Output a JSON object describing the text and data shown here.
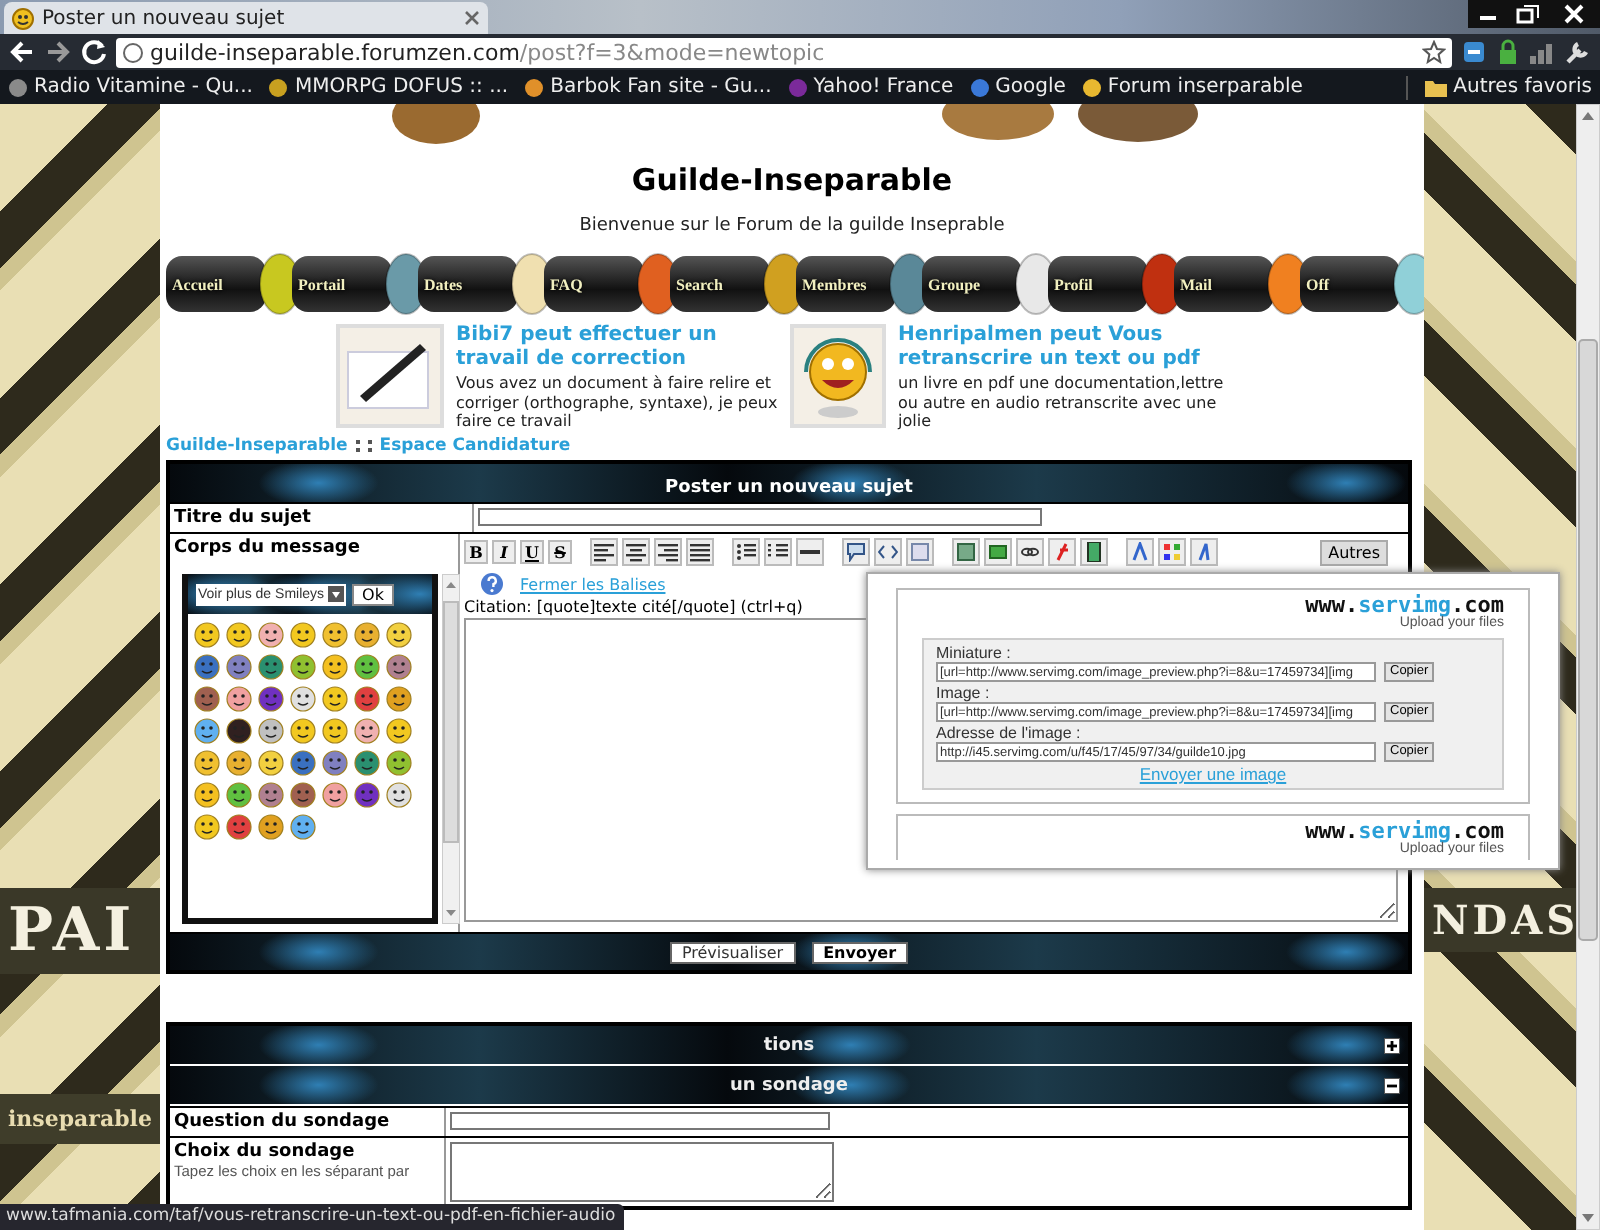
{
  "browser": {
    "tab_title": "Poster un nouveau sujet",
    "url_host": "guilde-inseparable.forumzen.com",
    "url_path": "/post?f=3&mode=newtopic",
    "bookmarks": [
      {
        "label": "Radio Vitamine - Qu...",
        "color": "#8a8a8a"
      },
      {
        "label": "MMORPG DOFUS :: ...",
        "color": "#c8a020"
      },
      {
        "label": "Barbok Fan site - Gu...",
        "color": "#e0902a"
      },
      {
        "label": "Yahoo! France",
        "color": "#7b2a9a"
      },
      {
        "label": "Google",
        "color": "#3a78d8"
      },
      {
        "label": "Forum inserparable",
        "color": "#e8b830"
      }
    ],
    "other_bookmarks": "Autres favoris"
  },
  "side": {
    "left_banner": "PAI",
    "right_banner": "NDAS",
    "left_label": "inseparable"
  },
  "header": {
    "title": "Guilde-Inseparable",
    "subtitle": "Bienvenue sur le Forum de la guilde Inseprable"
  },
  "nav": [
    {
      "label": "Accueil",
      "color": "#c8c820"
    },
    {
      "label": "Portail",
      "color": "#6a9aa8"
    },
    {
      "label": "Dates",
      "color": "#f0e0b0"
    },
    {
      "label": "FAQ",
      "color": "#e06020"
    },
    {
      "label": "Search",
      "color": "#d0a020"
    },
    {
      "label": "Membres",
      "color": "#5a8898"
    },
    {
      "label": "Groupe",
      "color": "#e8e8e8"
    },
    {
      "label": "Profil",
      "color": "#c03010"
    },
    {
      "label": "Mail",
      "color": "#f08020"
    },
    {
      "label": "Off",
      "color": "#90d0d8"
    }
  ],
  "ads": [
    {
      "kind": "pen",
      "title": "Bibi7 peut effectuer un travail de correction",
      "text": "Vous avez un document à faire relire et corriger (orthographe, syntaxe), je peux faire ce travail"
    },
    {
      "kind": "smiley",
      "title": "Henripalmen peut Vous retranscrire un text ou pdf",
      "text": "un livre en pdf une documentation,lettre ou autre en audio retranscrite avec une jolie"
    }
  ],
  "breadcrumb": [
    "Guilde-Inseparable",
    "Espace Candidature"
  ],
  "form": {
    "title": "Poster un nouveau sujet",
    "subject_label": "Titre du sujet",
    "body_label": "Corps du message",
    "smiley_select": "Voir plus de Smileys",
    "smiley_ok": "Ok",
    "format_buttons": [
      "B",
      "I",
      "U",
      "S"
    ],
    "more_button": "Autres",
    "close_tags": "Fermer les Balises",
    "hint": "Citation: [quote]texte cité[/quote] (ctrl+q)",
    "preview": "Prévisualiser",
    "send": "Envoyer"
  },
  "sections": [
    {
      "title": "tions",
      "expanded": false
    },
    {
      "title": "un sondage",
      "expanded": true
    }
  ],
  "poll": {
    "question_label": "Question du sondage",
    "choice_label": "Choix du sondage",
    "choice_hint": "Tapez les choix en les séparant par"
  },
  "servimg": {
    "logos": [
      {
        "parts": [
          "www.",
          "servimg",
          ".com"
        ],
        "tagline": "Upload your files"
      },
      {
        "parts": [
          "www.",
          "servimg",
          ".com"
        ],
        "tagline": "Upload your files"
      }
    ],
    "fields": [
      {
        "label": "Miniature :",
        "value": "[url=http://www.servimg.com/image_preview.php?i=8&u=17459734][img",
        "button": "Copier"
      },
      {
        "label": "Image :",
        "value": "[url=http://www.servimg.com/image_preview.php?i=8&u=17459734][img",
        "button": "Copier"
      },
      {
        "label": "Adresse de l'image :",
        "value": "http://i45.servimg.com/u/f45/17/45/97/34/guilde10.jpg",
        "button": "Copier"
      }
    ],
    "upload_link": "Envoyer une image"
  },
  "status_url": "www.tafmania.com/taf/vous-retranscrire-un-text-ou-pdf-en-fichier-audio"
}
